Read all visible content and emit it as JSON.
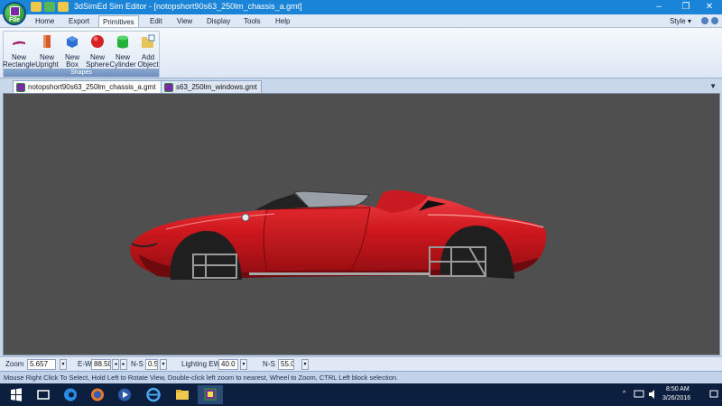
{
  "window": {
    "title": "3dSimEd Sim Editor - [notopshort90s63_250lm_chassis_a.gmt]",
    "controls": {
      "minimize": "–",
      "maximize": "❐",
      "close": "✕"
    }
  },
  "file_button": {
    "label": "File",
    "icon": "app-logo-icon"
  },
  "menu": {
    "items": [
      "Home",
      "Export",
      "Primitives",
      "Edit",
      "View",
      "Display",
      "Tools",
      "Help"
    ],
    "active": "Primitives",
    "style_label": "Style",
    "style_arrow": "▾"
  },
  "ribbon": {
    "group_label": "Shapes",
    "buttons": [
      {
        "line1": "New",
        "line2": "Rectangle",
        "icon": "rectangle-icon",
        "color": "#a0206a"
      },
      {
        "line1": "New",
        "line2": "Upright",
        "icon": "upright-icon",
        "color": "#d85a2a"
      },
      {
        "line1": "New",
        "line2": "Box",
        "icon": "box-icon",
        "color": "#2d6fd1"
      },
      {
        "line1": "New",
        "line2": "Sphere",
        "icon": "sphere-icon",
        "color": "#d42222"
      },
      {
        "line1": "New",
        "line2": "Cylinder",
        "icon": "cylinder-icon",
        "color": "#22b43a"
      },
      {
        "line1": "Add",
        "line2": "Object",
        "icon": "add-object-icon",
        "color": "#e6c45a"
      }
    ]
  },
  "tabs": [
    {
      "label": "notopshort90s63_250lm_chassis_a.gmt",
      "close": "✕",
      "active": true
    },
    {
      "label": "s63_250lm_windows.gmt",
      "active": false
    }
  ],
  "tab_scroll_arrow": "▼",
  "controls": {
    "zoom": {
      "label": "Zoom",
      "value": "5.657"
    },
    "ew": {
      "label": "E-W",
      "value": "88.50",
      "left": "◂",
      "right": "▸"
    },
    "ns": {
      "label": "N-S",
      "value": "0.5"
    },
    "lighting_ew": {
      "label": "Lighting EW",
      "value": "40.0"
    },
    "lighting_ns": {
      "label": "N-S",
      "value": "55.0"
    }
  },
  "status": {
    "text": "Mouse Right Click To Select, Hold Left to Rotate View, Double-click left  zoom to nearest, Wheel to Zoom, CTRL Left block selection."
  },
  "taskbar": {
    "time": "8:50 AM",
    "date": "3/26/2016",
    "tray_arrow": "^"
  },
  "colors": {
    "car_body": "#c8161c",
    "viewport_bg": "#4f4f4f",
    "titlebar": "#1a84d8",
    "taskbar": "#0c1f3f"
  }
}
